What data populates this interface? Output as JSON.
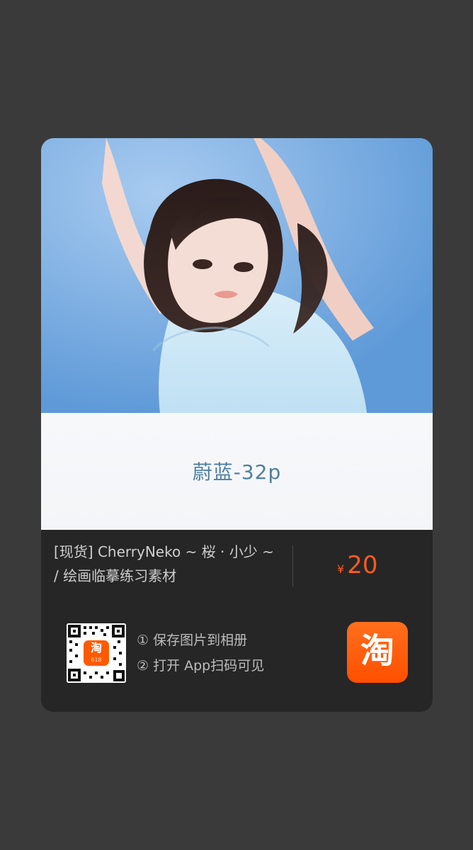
{
  "card": {
    "caption": "蔚蓝-32p",
    "title": "[现货] CherryNeko ~ 桜 · 小少 ~ / 绘画临摹练习素材",
    "price": {
      "currency": "¥",
      "value": "20"
    },
    "steps": [
      "① 保存图片到相册",
      "② 打开 App扫码可见"
    ],
    "qr_badge": "淘",
    "qr_subbadge": "618",
    "logo_text": "淘"
  },
  "colors": {
    "page_bg": "#3a3a3a",
    "card_bg": "#262626",
    "price": "#ff5a1f",
    "logo_bg": "#ff5a00",
    "caption_text": "#4f7f9f"
  },
  "icons": {
    "qr": "qr-code-icon",
    "logo": "taobao-logo-icon"
  }
}
